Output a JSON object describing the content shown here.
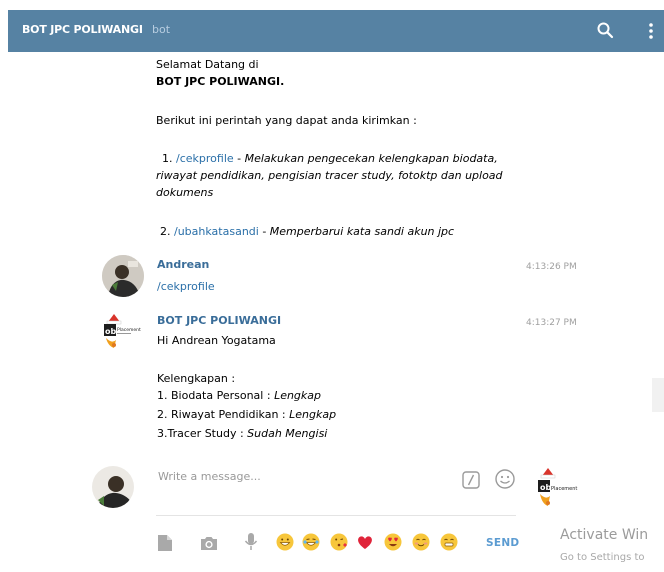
{
  "header": {
    "title": "BOT JPC POLIWANGI",
    "subtitle": "bot"
  },
  "welcome": {
    "line1": "Selamat Datang di",
    "line2": "BOT JPC POLIWANGI.",
    "line3": "Berikut ini perintah yang dapat anda kirimkan :",
    "cmd1_num": "1.",
    "cmd1": "/cekprofile",
    "cmd1_sep": " - ",
    "cmd1_desc_a": "Melakukan pengecekan kelengkapan biodata,",
    "cmd1_desc_b": "riwayat pendidikan, pengisian tracer study, fotoktp dan upload",
    "cmd1_desc_c": "dokumens",
    "cmd2_num": "2.",
    "cmd2": "/ubahkatasandi",
    "cmd2_sep": " - ",
    "cmd2_desc": "Memperbarui kata sandi akun jpc"
  },
  "msg_user": {
    "sender": "Andrean",
    "time": "4:13:26 PM",
    "text": "/cekprofile"
  },
  "msg_bot": {
    "sender": "BOT JPC POLIWANGI",
    "time": "4:13:27 PM",
    "greeting": "Hi Andrean Yogatama",
    "heading": "Kelengkapan :",
    "item1_label": "1. Biodata Personal : ",
    "item1_value": "Lengkap",
    "item2_label": "2. Riwayat Pendidikan : ",
    "item2_value": "Lengkap",
    "item3_label": " 3.Tracer Study : ",
    "item3_value": "Sudah Mengisi"
  },
  "composer": {
    "placeholder": "Write a message...",
    "send_label": "SEND"
  },
  "bot_logo": {
    "text_main": "Placement",
    "text_prefix": "ob"
  },
  "watermark": {
    "line1": "Activate Win",
    "line2": "Go to Settings to"
  },
  "icons": [
    "search-icon",
    "more-vert-icon",
    "commands-icon",
    "emoji-icon",
    "file-icon",
    "camera-icon",
    "microphone-icon"
  ],
  "colors": {
    "header": "#5682a3",
    "link": "#2a6fa8",
    "sender": "#3a6d99",
    "send": "#5b9bd1"
  }
}
